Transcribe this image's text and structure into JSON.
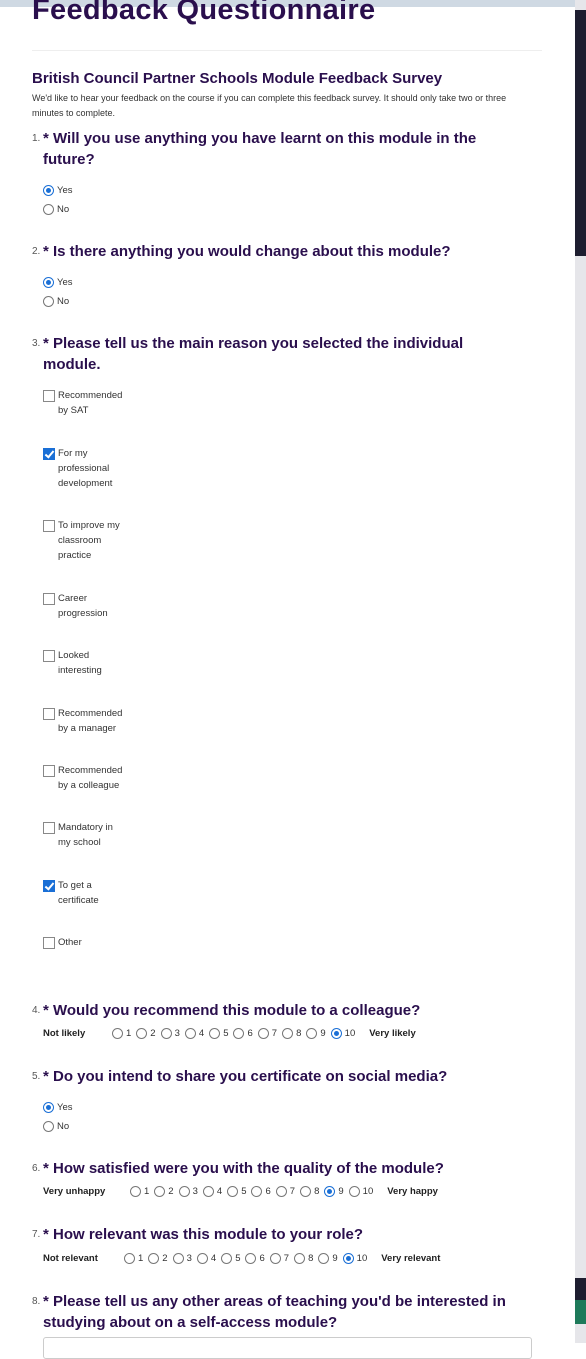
{
  "page": {
    "title": "Feedback Questionnaire"
  },
  "survey": {
    "title": "British Council Partner Schools Module Feedback Survey",
    "description": "We'd like to hear your feedback on the course if you can complete this feedback survey. It should only take two or three minutes to complete."
  },
  "questions": [
    {
      "number": "1.",
      "text": "* Will you use anything you have learnt on this module in the future?",
      "options": [
        {
          "label": "Yes",
          "selected": true
        },
        {
          "label": "No",
          "selected": false
        }
      ]
    },
    {
      "number": "2.",
      "text": "* Is there anything you would change about this module?",
      "options": [
        {
          "label": "Yes",
          "selected": true
        },
        {
          "label": "No",
          "selected": false
        }
      ]
    },
    {
      "number": "3.",
      "text": "* Please tell us the main reason you selected the individual module.",
      "options": [
        {
          "label": "Recommended by SAT",
          "checked": false
        },
        {
          "label": "For my professional development",
          "checked": true
        },
        {
          "label": "To improve my classroom practice",
          "checked": false
        },
        {
          "label": "Career progression",
          "checked": false
        },
        {
          "label": "Looked interesting",
          "checked": false
        },
        {
          "label": "Recommended by a manager",
          "checked": false
        },
        {
          "label": "Recommended by a colleague",
          "checked": false
        },
        {
          "label": "Mandatory in my school",
          "checked": false
        },
        {
          "label": "To get a certificate",
          "checked": true
        },
        {
          "label": "Other",
          "checked": false
        }
      ]
    },
    {
      "number": "4.",
      "text": "* Would you recommend this module to a colleague?",
      "low_label": "Not likely",
      "high_label": "Very likely",
      "scale": [
        "1",
        "2",
        "3",
        "4",
        "5",
        "6",
        "7",
        "8",
        "9",
        "10"
      ],
      "selected": "10"
    },
    {
      "number": "5.",
      "text": "* Do you intend to share you certificate on social media?",
      "options": [
        {
          "label": "Yes",
          "selected": true
        },
        {
          "label": "No",
          "selected": false
        }
      ]
    },
    {
      "number": "6.",
      "text": "* How satisfied were you with the quality of the module?",
      "low_label": "Very unhappy",
      "high_label": "Very happy",
      "scale": [
        "1",
        "2",
        "3",
        "4",
        "5",
        "6",
        "7",
        "8",
        "9",
        "10"
      ],
      "selected": "9"
    },
    {
      "number": "7.",
      "text": "* How relevant was this module to your role?",
      "low_label": "Not relevant",
      "high_label": "Very relevant",
      "scale": [
        "1",
        "2",
        "3",
        "4",
        "5",
        "6",
        "7",
        "8",
        "9",
        "10"
      ],
      "selected": "10"
    },
    {
      "number": "8.",
      "text": "* Please tell us any other areas of teaching you'd be interested in studying about on a self-access module?"
    }
  ],
  "colors": {
    "heading": "#2a0f4d",
    "accent": "#1a6fd6"
  }
}
